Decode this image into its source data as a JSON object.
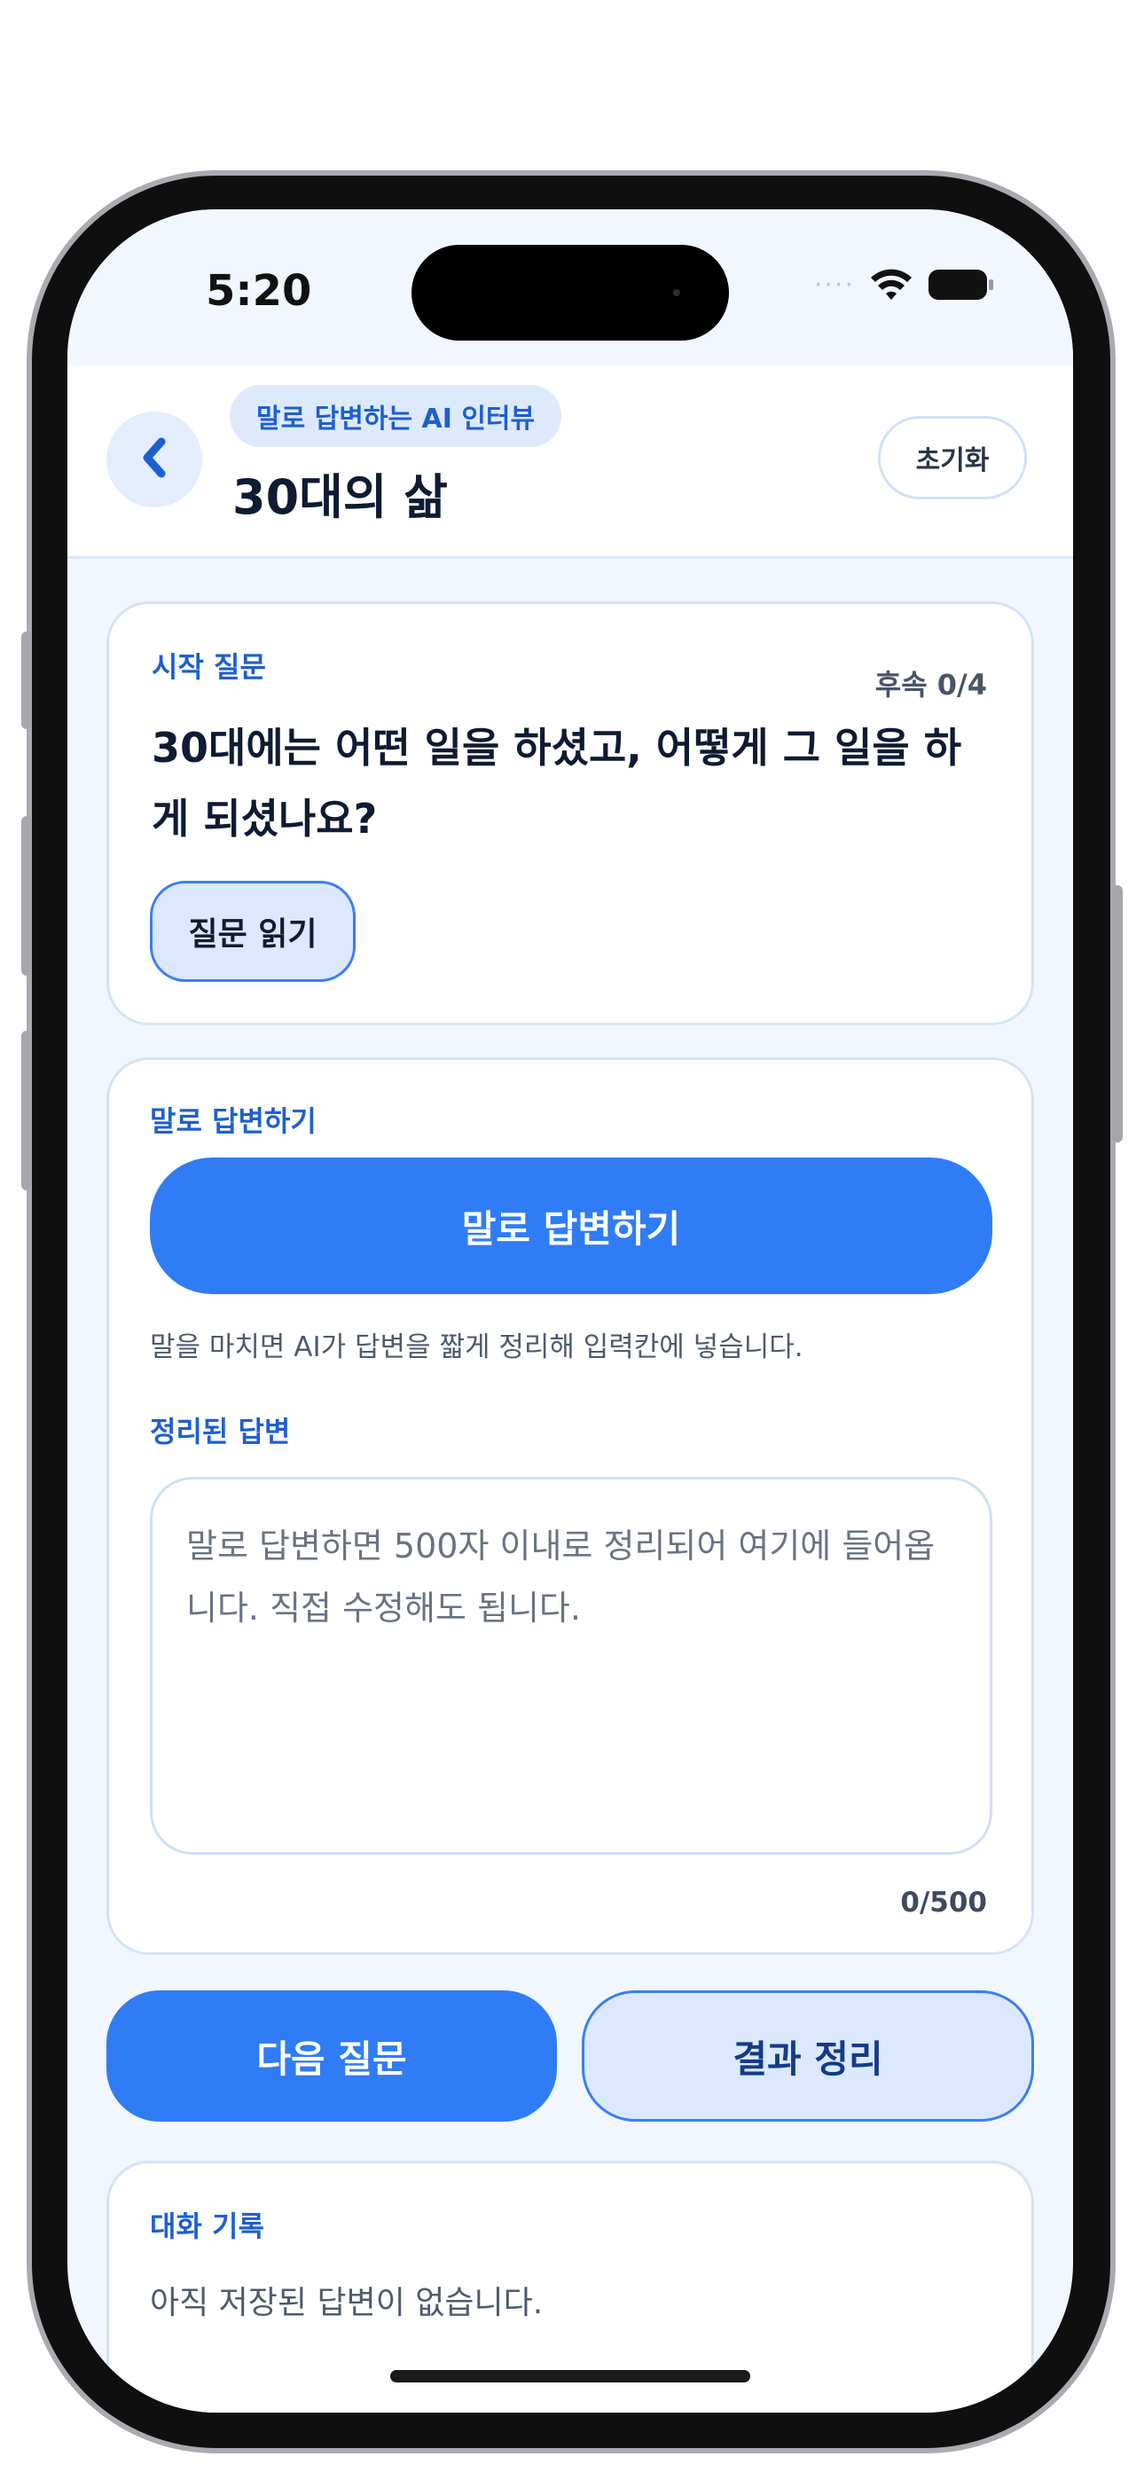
{
  "status": {
    "time": "5:20",
    "signal": "····"
  },
  "header": {
    "eyebrow": "말로 답변하는 AI 인터뷰",
    "title": "30대의 삶",
    "reset_label": "초기화"
  },
  "question_card": {
    "label": "시작 질문",
    "count": "후속 0/4",
    "question": "30대에는 어떤 일을 하셨고, 어떻게 그 일을 하게 되셨나요?",
    "read_label": "질문 읽기"
  },
  "answer_card": {
    "label": "말로 답변하기",
    "speak_label": "말로 답변하기",
    "hint": "말을 마치면 AI가 답변을 짧게 정리해 입력칸에 넣습니다.",
    "summary_label": "정리된 답변",
    "placeholder": "말로 답변하면 500자 이내로 정리되어 여기에 들어옵니다. 직접 수정해도 됩니다.",
    "char_count": "0/500"
  },
  "actions": {
    "next_label": "다음 질문",
    "result_label": "결과 정리"
  },
  "history": {
    "label": "대화 기록",
    "empty_text": "아직 저장된 답변이 없습니다."
  },
  "icons": {
    "back": "chevron-left-icon",
    "wifi": "wifi-icon",
    "battery": "battery-icon"
  },
  "colors": {
    "accent": "#2f7cf6",
    "accent_soft": "#dbe8fd",
    "label_blue": "#1e5fd0",
    "background": "#f2f7ff"
  }
}
